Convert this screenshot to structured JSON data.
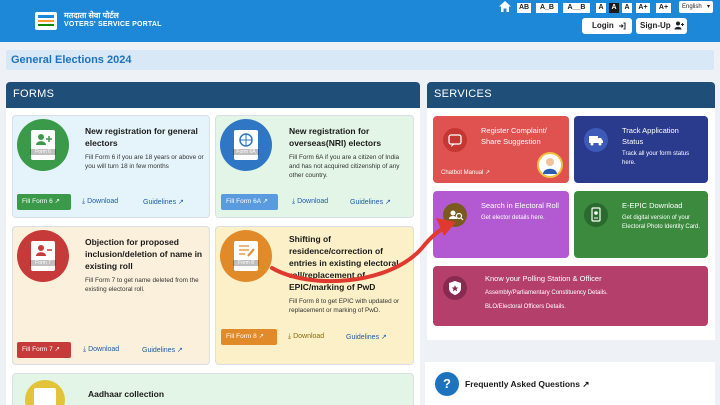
{
  "header": {
    "brand_hindi": "मतदाता सेवा पोर्टल",
    "brand_english": "VOTERS' SERVICE PORTAL",
    "font_sizes": [
      "A",
      "A",
      "A",
      "A",
      "A",
      "A+"
    ],
    "font_size_labels": [
      "AB",
      "A_B",
      "A__B",
      "A",
      "A",
      "A+"
    ],
    "language": "English",
    "login_label": "Login",
    "signup_label": "Sign-Up"
  },
  "elections": {
    "title": "General Elections 2024"
  },
  "forms": {
    "heading": "FORMS",
    "cards": [
      {
        "icon_label": "Form 6",
        "title": "New registration for general electors",
        "desc": "Fill Form 6 if you are 18 years or above or you will turn 18 in few months",
        "fill_label": "Fill Form 6",
        "download_label": "Download",
        "guidelines_label": "Guidelines"
      },
      {
        "icon_label": "Form 6A",
        "title": "New registration for overseas(NRI) electors",
        "desc": "Fill Form 6A if you are a citizen of India and has not acquired citizenship of any other country.",
        "fill_label": "Fill Form 6A",
        "download_label": "Download",
        "guidelines_label": "Guidelines"
      },
      {
        "icon_label": "Form 7",
        "title": "Objection for proposed inclusion/deletion of name in existing roll",
        "desc": "Fill Form 7 to get name deleted from the existing electoral roll.",
        "fill_label": "Fill Form 7",
        "download_label": "Download",
        "guidelines_label": "Guidelines"
      },
      {
        "icon_label": "Form 8",
        "title": "Shifting of residence/correction of entries in existing electoral roll/replacement of EPIC/marking of PwD",
        "desc": "Fill Form 8 to get EPIC with updated or replacement or marking of PwD.",
        "fill_label": "Fill Form 8",
        "download_label": "Download",
        "guidelines_label": "Guidelines"
      },
      {
        "title": "Aadhaar collection"
      }
    ]
  },
  "services": {
    "heading": "SERVICES",
    "items": [
      {
        "title": "Register Complaint/ Share Suggestion",
        "sub": "Chatbot Manual",
        "color": "#e0524f"
      },
      {
        "title": "Track Application Status",
        "desc": "Track all your form status here.",
        "color": "#2a3a8c"
      },
      {
        "title": "Search in Electoral Roll",
        "desc": "Get elector details here.",
        "color": "#b35ad2"
      },
      {
        "title": "E-EPIC Download",
        "desc": "Get digital version of your Electoral Photo Identity Card.",
        "color": "#3b8a3e"
      },
      {
        "title": "Know your Polling Station & Officer",
        "desc": "Assembly/Parliamentary Constituency Details.",
        "desc2": "BLO/Electoral Officers Details.",
        "color": "#b43f6b"
      }
    ],
    "faq_label": "Frequently Asked Questions"
  },
  "colors": {
    "header_blue": "#1e88d8",
    "panel_navy": "#1f4f78",
    "arrow_red": "#e03a2f"
  },
  "icons": [
    "home-icon",
    "login-icon",
    "add-user-icon",
    "external-link-icon",
    "download-icon",
    "chat-icon",
    "truck-icon",
    "search-user-icon",
    "id-card-icon",
    "shield-icon",
    "question-icon"
  ]
}
